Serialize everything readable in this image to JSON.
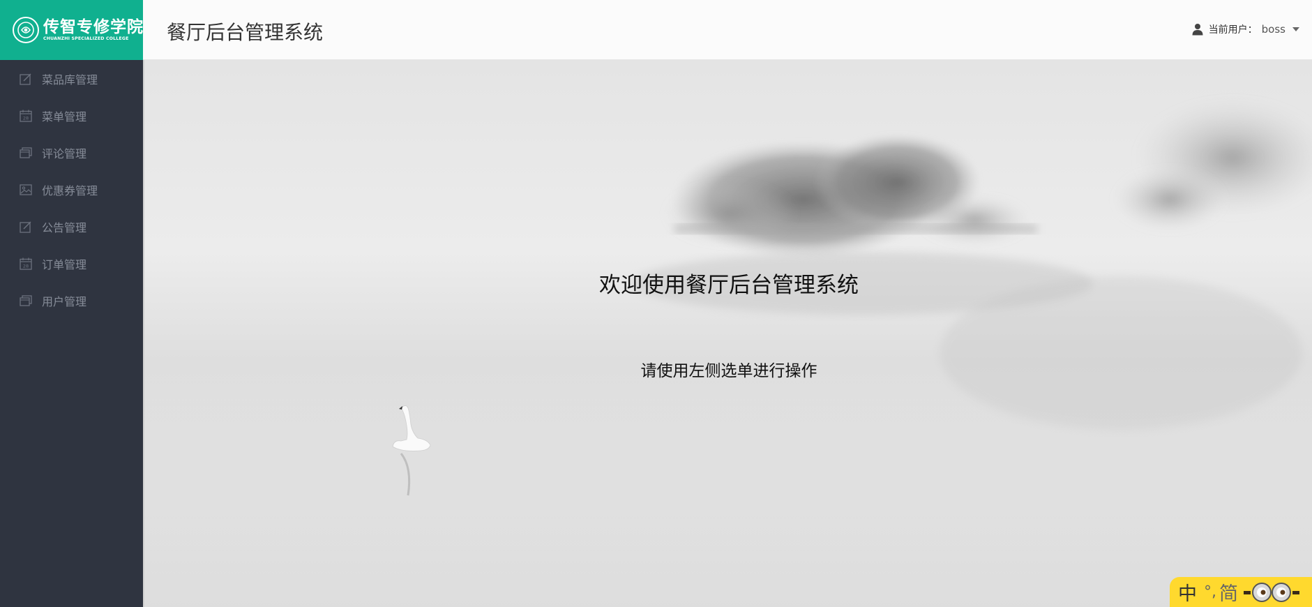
{
  "brand": {
    "logo_cn": "传智专修学院",
    "logo_en": "CHUANZHI SPECIALIZED COLLEGE",
    "accent_color": "#10b08f"
  },
  "header": {
    "title": "餐厅后台管理系统",
    "user_prefix": "当前用户：",
    "user_name": "boss"
  },
  "sidebar": {
    "items": [
      {
        "label": "菜品库管理",
        "icon": "edit-icon"
      },
      {
        "label": "菜单管理",
        "icon": "calendar-icon"
      },
      {
        "label": "评论管理",
        "icon": "window-icon"
      },
      {
        "label": "优惠券管理",
        "icon": "image-icon"
      },
      {
        "label": "公告管理",
        "icon": "edit-icon"
      },
      {
        "label": "订单管理",
        "icon": "calendar-icon"
      },
      {
        "label": "用户管理",
        "icon": "window-icon"
      }
    ]
  },
  "main": {
    "welcome_title": "欢迎使用餐厅后台管理系统",
    "welcome_sub": "请使用左侧选单进行操作"
  },
  "ime": {
    "mode": "中",
    "punct": "°,",
    "script": "简"
  }
}
